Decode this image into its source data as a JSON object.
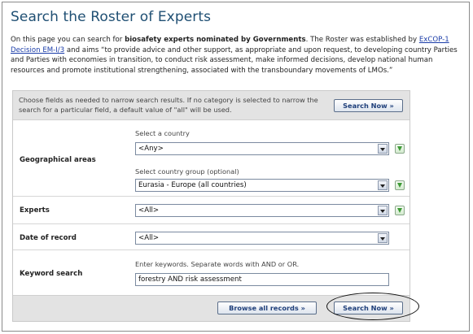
{
  "page": {
    "title": "Search the Roster of Experts",
    "intro": {
      "part1": "On this page you can search for ",
      "bold": "biosafety experts nominated by Governments",
      "part2": ". The Roster was established by ",
      "link": "ExCOP-1 Decision EM-I/3",
      "part3": " and aims “to provide advice and other support, as appropriate and upon request, to developing country Parties and Parties with economies in transition, to conduct risk assessment, make informed decisions, develop national human resources and promote institutional strengthening, associated with the transboundary movements of LMOs.”"
    }
  },
  "form": {
    "hint": "Choose fields as needed to narrow search results. If no category is selected to narrow the search for a particular field, a default value of \"all\" will be used.",
    "search_now_label": "Search Now »",
    "browse_all_label": "Browse all records »",
    "geo": {
      "label": "Geographical areas",
      "country_label": "Select a country",
      "country_value": "<Any>",
      "group_label": "Select country group (optional)",
      "group_value": "Eurasia - Europe (all countries)"
    },
    "experts": {
      "label": "Experts",
      "value": "<All>"
    },
    "date": {
      "label": "Date of record",
      "value": "<All>"
    },
    "keyword": {
      "label": "Keyword search",
      "hint": "Enter keywords. Separate words with AND or OR.",
      "value": "forestry AND risk assessment"
    }
  },
  "icons": {
    "select_arrow": "chevron-down-icon",
    "add_arrow": "green-arrow-down-icon"
  },
  "colors": {
    "title": "#1f4f73",
    "link": "#1a3ca8",
    "band": "#e3e3e3",
    "button_text": "#1f3f7a",
    "add_arrow": "#3e9a36"
  }
}
